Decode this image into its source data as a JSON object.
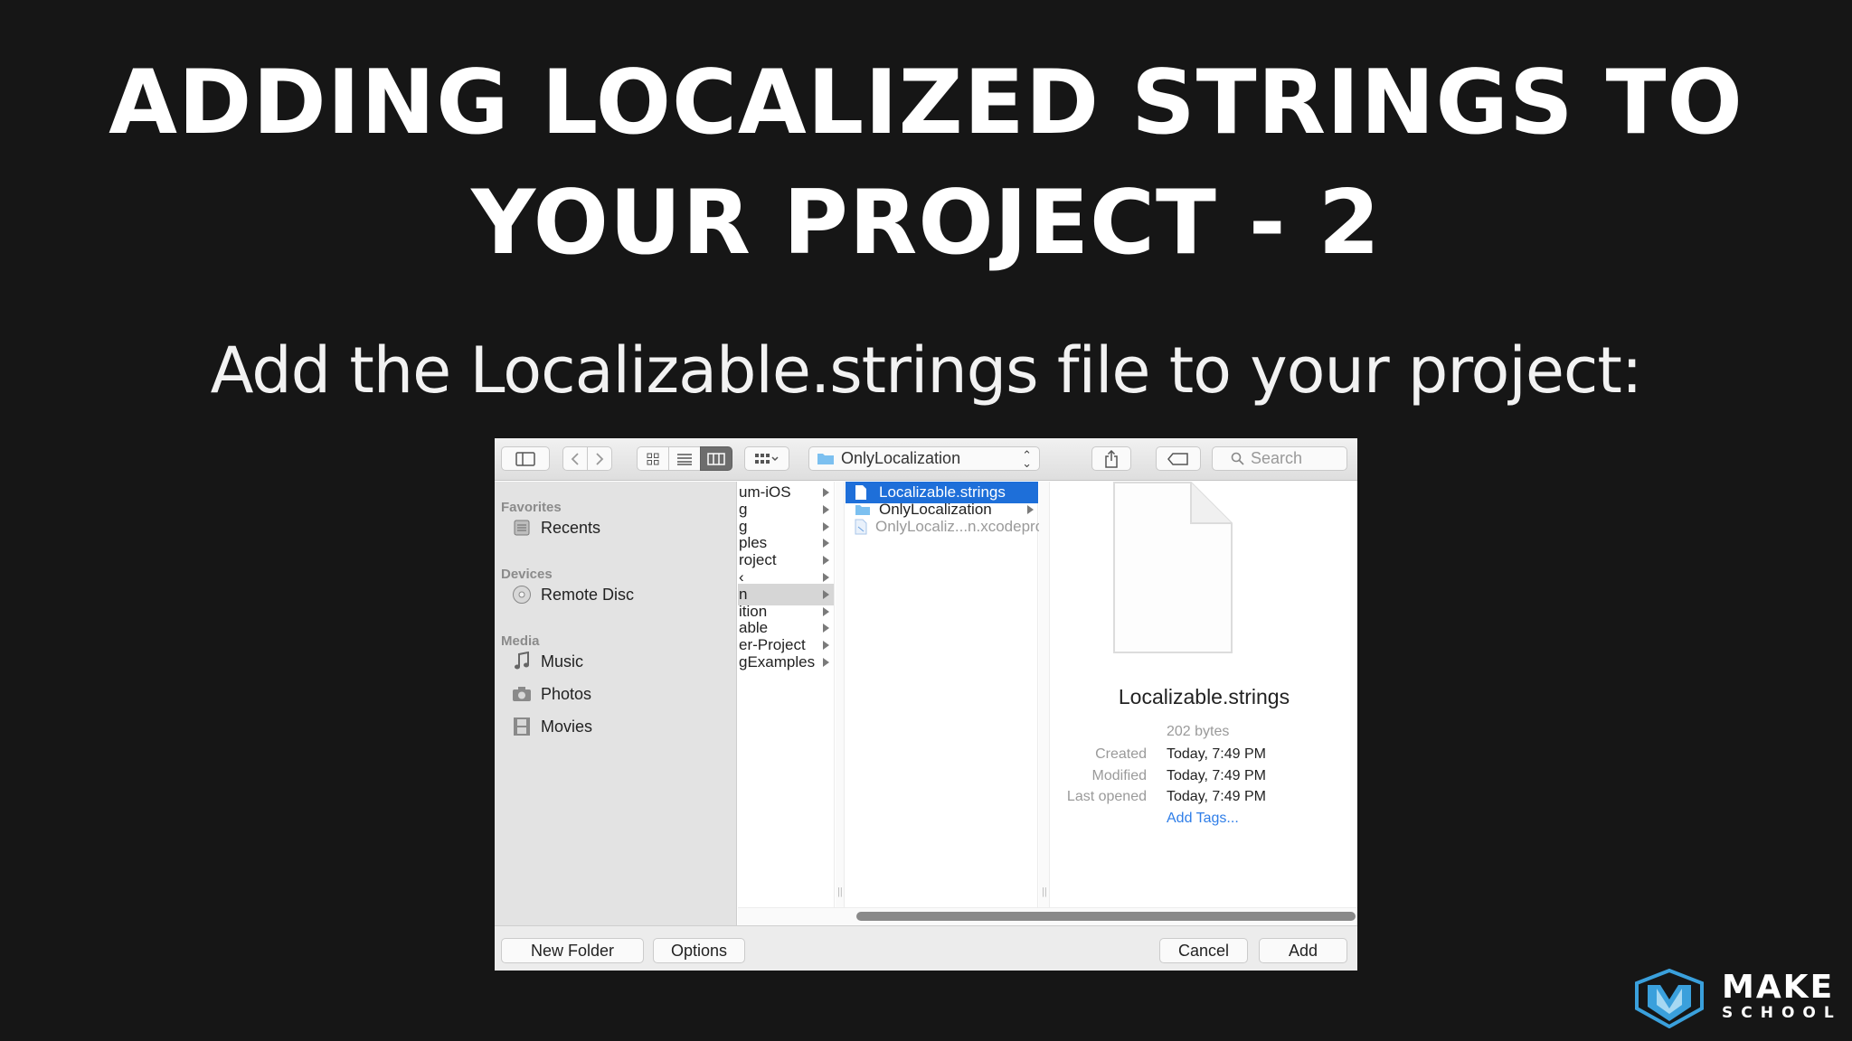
{
  "slide": {
    "title_line1": "ADDING LOCALIZED STRINGS TO",
    "title_line2": "YOUR PROJECT - 2",
    "subtitle": "Add the Localizable.strings file to your project:"
  },
  "toolbar": {
    "path_label": "OnlyLocalization",
    "search_placeholder": "Search",
    "view_mode_selected": "columns"
  },
  "sidebar": {
    "sections": [
      {
        "label": "Favorites",
        "items": [
          {
            "label": "Recents",
            "icon": "recents-icon"
          }
        ]
      },
      {
        "label": "Devices",
        "items": [
          {
            "label": "Remote Disc",
            "icon": "disc-icon"
          }
        ]
      },
      {
        "label": "Media",
        "items": [
          {
            "label": "Music",
            "icon": "music-icon"
          },
          {
            "label": "Photos",
            "icon": "camera-icon"
          },
          {
            "label": "Movies",
            "icon": "film-icon"
          }
        ]
      }
    ]
  },
  "column1": {
    "rows": [
      "um-iOS",
      "g",
      "g",
      "ples",
      "roject",
      "‹",
      "n",
      "ition",
      "able",
      "er-Project",
      "gExamples"
    ]
  },
  "column2": {
    "rows": [
      {
        "label": "Localizable.strings",
        "type": "file",
        "selected": true
      },
      {
        "label": "OnlyLocalization",
        "type": "folder",
        "selected": false
      },
      {
        "label": "OnlyLocaliz...n.xcodeproj",
        "type": "xcodeproj",
        "selected": false
      }
    ]
  },
  "preview": {
    "filename": "Localizable.strings",
    "size": "202 bytes",
    "created_label": "Created",
    "created_value": "Today, 7:49 PM",
    "modified_label": "Modified",
    "modified_value": "Today, 7:49 PM",
    "last_opened_label": "Last opened",
    "last_opened_value": "Today, 7:49 PM",
    "add_tags": "Add Tags..."
  },
  "bottom_bar": {
    "new_folder": "New Folder",
    "options": "Options",
    "cancel": "Cancel",
    "add": "Add"
  },
  "brand": {
    "line1": "MAKE",
    "line2": "SCHOOL",
    "accent": "#3aa0dc"
  },
  "colors": {
    "background": "#161616",
    "selection_blue": "#1e6fd9",
    "link_blue": "#2f7ee8"
  }
}
